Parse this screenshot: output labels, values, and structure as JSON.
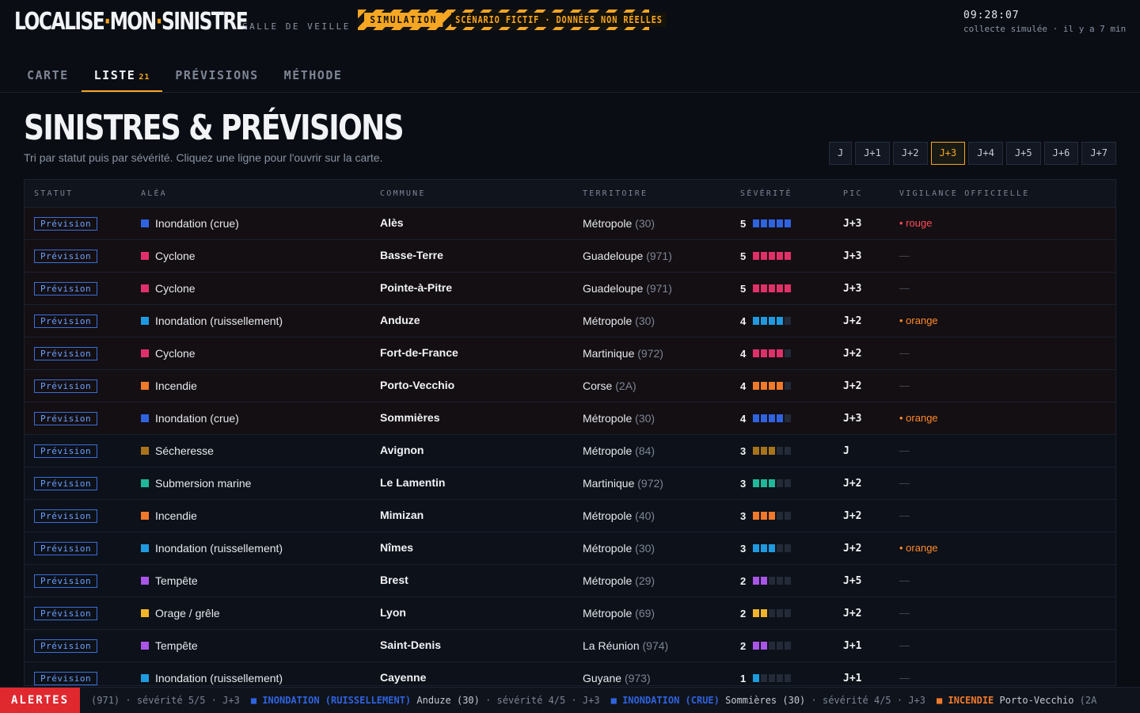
{
  "header": {
    "logo_a": "LOCALISE",
    "logo_b": "MON",
    "logo_c": "SINISTRE",
    "salle": "SALLE DE VEILLE",
    "tape_a": "SIMULATION",
    "tape_b": "SCÉNARIO FICTIF · DONNÉES NON RÉELLES",
    "time": "09:28:07",
    "collect": "collecte simulée · il y a 7 min"
  },
  "tabs": [
    {
      "label": "CARTE"
    },
    {
      "label": "LISTE",
      "count": "21"
    },
    {
      "label": "PRÉVISIONS"
    },
    {
      "label": "MÉTHODE"
    }
  ],
  "page": {
    "title": "SINISTRES & PRÉVISIONS",
    "subtitle": "Tri par statut puis par sévérité. Cliquez une ligne pour l'ouvrir sur la carte."
  },
  "days": [
    "J",
    "J+1",
    "J+2",
    "J+3",
    "J+4",
    "J+5",
    "J+6",
    "J+7"
  ],
  "active_day": "J+3",
  "columns": [
    "STATUT",
    "ALÉA",
    "COMMUNE",
    "TERRITOIRE",
    "SÉVÉRITÉ",
    "PIC",
    "VIGILANCE OFFICIELLE"
  ],
  "rows": [
    {
      "statut": "Prévision",
      "alea": "Inondation (crue)",
      "color": "#2f63e0",
      "commune": "Alès",
      "territoire": "Métropole",
      "code": "(30)",
      "sev": "5",
      "pic": "J+3",
      "vig": "rouge",
      "vigtext": "rouge"
    },
    {
      "statut": "Prévision",
      "alea": "Cyclone",
      "color": "#e0306a",
      "commune": "Basse-Terre",
      "territoire": "Guadeloupe",
      "code": "(971)",
      "sev": "5",
      "pic": "J+3",
      "vig": "none",
      "vigtext": "—"
    },
    {
      "statut": "Prévision",
      "alea": "Cyclone",
      "color": "#e0306a",
      "commune": "Pointe-à-Pitre",
      "territoire": "Guadeloupe",
      "code": "(971)",
      "sev": "5",
      "pic": "J+3",
      "vig": "none",
      "vigtext": "—"
    },
    {
      "statut": "Prévision",
      "alea": "Inondation (ruissellement)",
      "color": "#1e9be0",
      "commune": "Anduze",
      "territoire": "Métropole",
      "code": "(30)",
      "sev": "4",
      "pic": "J+2",
      "vig": "orange",
      "vigtext": "orange"
    },
    {
      "statut": "Prévision",
      "alea": "Cyclone",
      "color": "#e0306a",
      "commune": "Fort-de-France",
      "territoire": "Martinique",
      "code": "(972)",
      "sev": "4",
      "pic": "J+2",
      "vig": "none",
      "vigtext": "—"
    },
    {
      "statut": "Prévision",
      "alea": "Incendie",
      "color": "#f07a2a",
      "commune": "Porto-Vecchio",
      "territoire": "Corse",
      "code": "(2A)",
      "sev": "4",
      "pic": "J+2",
      "vig": "none",
      "vigtext": "—"
    },
    {
      "statut": "Prévision",
      "alea": "Inondation (crue)",
      "color": "#2f63e0",
      "commune": "Sommières",
      "territoire": "Métropole",
      "code": "(30)",
      "sev": "4",
      "pic": "J+3",
      "vig": "orange",
      "vigtext": "orange"
    },
    {
      "statut": "Prévision",
      "alea": "Sécheresse",
      "color": "#a8741a",
      "commune": "Avignon",
      "territoire": "Métropole",
      "code": "(84)",
      "sev": "3",
      "pic": "J",
      "vig": "none",
      "vigtext": "—"
    },
    {
      "statut": "Prévision",
      "alea": "Submersion marine",
      "color": "#1fb89a",
      "commune": "Le Lamentin",
      "territoire": "Martinique",
      "code": "(972)",
      "sev": "3",
      "pic": "J+2",
      "vig": "none",
      "vigtext": "—"
    },
    {
      "statut": "Prévision",
      "alea": "Incendie",
      "color": "#f07a2a",
      "commune": "Mimizan",
      "territoire": "Métropole",
      "code": "(40)",
      "sev": "3",
      "pic": "J+2",
      "vig": "none",
      "vigtext": "—"
    },
    {
      "statut": "Prévision",
      "alea": "Inondation (ruissellement)",
      "color": "#1e9be0",
      "commune": "Nîmes",
      "territoire": "Métropole",
      "code": "(30)",
      "sev": "3",
      "pic": "J+2",
      "vig": "orange",
      "vigtext": "orange"
    },
    {
      "statut": "Prévision",
      "alea": "Tempête",
      "color": "#a855e8",
      "commune": "Brest",
      "territoire": "Métropole",
      "code": "(29)",
      "sev": "2",
      "pic": "J+5",
      "vig": "none",
      "vigtext": "—"
    },
    {
      "statut": "Prévision",
      "alea": "Orage / grêle",
      "color": "#f0b428",
      "commune": "Lyon",
      "territoire": "Métropole",
      "code": "(69)",
      "sev": "2",
      "pic": "J+2",
      "vig": "none",
      "vigtext": "—"
    },
    {
      "statut": "Prévision",
      "alea": "Tempête",
      "color": "#a855e8",
      "commune": "Saint-Denis",
      "territoire": "La Réunion",
      "code": "(974)",
      "sev": "2",
      "pic": "J+1",
      "vig": "none",
      "vigtext": "—"
    },
    {
      "statut": "Prévision",
      "alea": "Inondation (ruissellement)",
      "color": "#1e9be0",
      "commune": "Cayenne",
      "territoire": "Guyane",
      "code": "(973)",
      "sev": "1",
      "pic": "J+1",
      "vig": "none",
      "vigtext": "—"
    }
  ],
  "ticker": {
    "label": "ALERTES",
    "items": [
      {
        "pre": "(971) · sévérité 5/5 · J+3",
        "hz": "",
        "color": "",
        "place": ""
      },
      {
        "hz": "INONDATION (RUISSELLEMENT)",
        "color": "#2f63e0",
        "place": "Anduze (30)",
        "post": "· sévérité 4/5 · J+3"
      },
      {
        "hz": "INONDATION (CRUE)",
        "color": "#2f63e0",
        "place": "Sommières (30)",
        "post": "· sévérité 4/5 · J+3"
      },
      {
        "hz": "INCENDIE",
        "color": "#f07a2a",
        "place": "Porto-Vecchio",
        "post": "(2A"
      }
    ]
  }
}
